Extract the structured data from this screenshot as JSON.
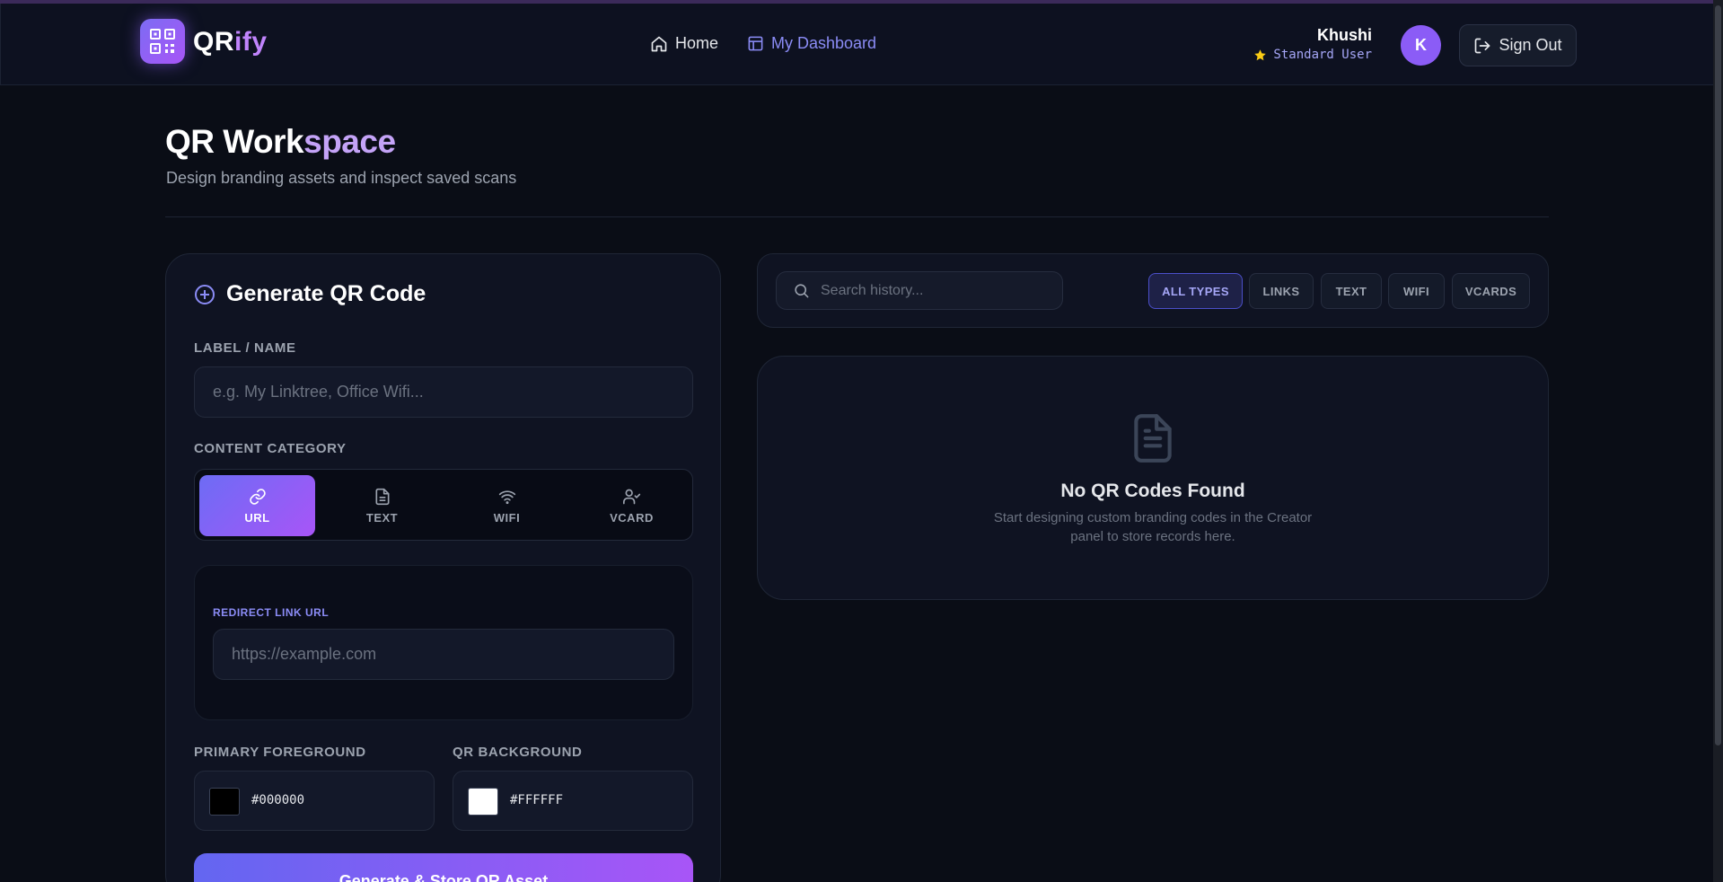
{
  "header": {
    "logo": {
      "part1": "QR",
      "part2": "ify"
    },
    "nav": {
      "home": "Home",
      "dashboard": "My Dashboard"
    },
    "user": {
      "name": "Khushi",
      "role": "Standard User",
      "avatar_initial": "K"
    },
    "sign_out": "Sign Out"
  },
  "page": {
    "title_part1": "QR Work",
    "title_part2": "space",
    "subtitle": "Design branding assets and inspect saved scans"
  },
  "generator": {
    "title": "Generate QR Code",
    "label_field": {
      "label": "LABEL / NAME",
      "placeholder": "e.g. My Linktree, Office Wifi..."
    },
    "category": {
      "label": "CONTENT CATEGORY",
      "items": [
        {
          "label": "URL",
          "icon": "link-icon",
          "active": true
        },
        {
          "label": "TEXT",
          "icon": "document-icon",
          "active": false
        },
        {
          "label": "WIFI",
          "icon": "wifi-icon",
          "active": false
        },
        {
          "label": "VCARD",
          "icon": "user-check-icon",
          "active": false
        }
      ]
    },
    "url_field": {
      "label": "REDIRECT LINK URL",
      "placeholder": "https://example.com"
    },
    "foreground": {
      "label": "PRIMARY FOREGROUND",
      "value": "#000000"
    },
    "background": {
      "label": "QR BACKGROUND",
      "value": "#FFFFFF"
    },
    "submit": "Generate & Store QR Asset"
  },
  "history": {
    "search_placeholder": "Search history...",
    "filters": [
      "ALL TYPES",
      "LINKS",
      "TEXT",
      "WIFI",
      "VCARDS"
    ],
    "active_filter": "ALL TYPES",
    "empty": {
      "title": "No QR Codes Found",
      "description": "Start designing custom branding codes in the Creator panel to store records here."
    }
  },
  "colors": {
    "accent": "#8b5cf6",
    "accent_gradient_start": "#6366f1",
    "accent_gradient_end": "#a855f7",
    "background": "#0a0d16"
  }
}
